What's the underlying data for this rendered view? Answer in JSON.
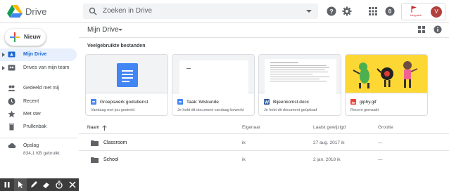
{
  "app": {
    "brand": "Drive"
  },
  "search": {
    "placeholder": "Zoeken in Drive"
  },
  "account": {
    "org_text": "tobypack",
    "avatar_letter": "V"
  },
  "sidebar": {
    "new_label": "Nieuw",
    "items": [
      {
        "label": "Mijn Drive",
        "icon": "drive-folder-icon",
        "active": true
      },
      {
        "label": "Drives van mijn team",
        "icon": "team-drive-icon",
        "active": false
      },
      {
        "label": "Gedeeld met mij",
        "icon": "people-icon",
        "active": false
      },
      {
        "label": "Recent",
        "icon": "clock-icon",
        "active": false
      },
      {
        "label": "Met ster",
        "icon": "star-icon",
        "active": false
      },
      {
        "label": "Prullenbak",
        "icon": "trash-icon",
        "active": false
      }
    ],
    "storage": {
      "label": "Opslag",
      "used": "834,1 KB gebruikt"
    }
  },
  "main": {
    "title": "Mijn Drive",
    "quick_access_title": "Veelgebruikte bestanden",
    "cards": [
      {
        "name": "Groepswerk godsdienst",
        "sub": "Vandaag met jou gedeeld",
        "type": "google-doc"
      },
      {
        "name": "Taak: Wiskunde",
        "sub": "Je hebt dit document vandaag bewerkt",
        "type": "google-doc"
      },
      {
        "name": "Bijeenkomst.docx",
        "sub": "Je hebt dit document geüpload",
        "type": "word-doc"
      },
      {
        "name": "giphy.gif",
        "sub": "Recent gemaakt",
        "type": "image"
      }
    ],
    "table": {
      "headers": {
        "name": "Naam",
        "owner": "Eigenaar",
        "modified": "Laatst gewijzigd",
        "size": "Grootte"
      },
      "rows": [
        {
          "name": "Classroom",
          "owner": "ik",
          "modified": "27 aug. 2017 ik",
          "size": "—"
        },
        {
          "name": "School",
          "owner": "ik",
          "modified": "2 jan. 2018 ik",
          "size": "—"
        }
      ]
    }
  },
  "colors": {
    "accent": "#1967d2",
    "active_bg": "#e8f0fe",
    "gif_bg": "#fdd835"
  }
}
